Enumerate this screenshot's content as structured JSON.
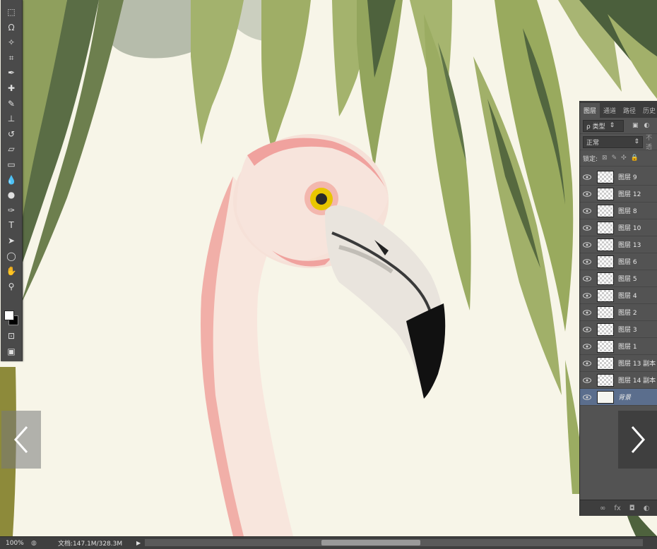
{
  "toolbar": {
    "tools": [
      {
        "name": "marquee-tool-icon",
        "glyph": "⬚"
      },
      {
        "name": "lasso-tool-icon",
        "glyph": "ᘯ"
      },
      {
        "name": "magic-wand-tool-icon",
        "glyph": "✧"
      },
      {
        "name": "crop-tool-icon",
        "glyph": "⌗"
      },
      {
        "name": "eyedropper-tool-icon",
        "glyph": "✒"
      },
      {
        "name": "healing-brush-tool-icon",
        "glyph": "✚"
      },
      {
        "name": "brush-tool-icon",
        "glyph": "✎"
      },
      {
        "name": "clone-stamp-tool-icon",
        "glyph": "⊥"
      },
      {
        "name": "history-brush-tool-icon",
        "glyph": "↺"
      },
      {
        "name": "eraser-tool-icon",
        "glyph": "▱"
      },
      {
        "name": "gradient-tool-icon",
        "glyph": "▭"
      },
      {
        "name": "blur-tool-icon",
        "glyph": "💧"
      },
      {
        "name": "dodge-tool-icon",
        "glyph": "●"
      },
      {
        "name": "pen-tool-icon",
        "glyph": "✑"
      },
      {
        "name": "type-tool-icon",
        "glyph": "T"
      },
      {
        "name": "path-selection-tool-icon",
        "glyph": "➤"
      },
      {
        "name": "ellipse-tool-icon",
        "glyph": "◯"
      },
      {
        "name": "hand-tool-icon",
        "glyph": "✋"
      },
      {
        "name": "zoom-tool-icon",
        "glyph": "⚲"
      }
    ],
    "swatch_colors": {
      "foreground": "#ffffff",
      "background": "#000000"
    },
    "quick_mask_glyph": "⊡",
    "screen_mode_glyph": "▣"
  },
  "layers_panel": {
    "tabs": [
      "图层",
      "通道",
      "路径",
      "历史"
    ],
    "filter_label": "ρ 类型",
    "blend_mode": "正常",
    "opacity_label": "不透",
    "lock_label": "锁定:",
    "layers": [
      {
        "name": "图层 9",
        "selected": false
      },
      {
        "name": "图层 12",
        "selected": false
      },
      {
        "name": "图层 8",
        "selected": false
      },
      {
        "name": "图层 10",
        "selected": false
      },
      {
        "name": "图层 13",
        "selected": false
      },
      {
        "name": "图层 6",
        "selected": false
      },
      {
        "name": "图层 5",
        "selected": false
      },
      {
        "name": "图层 4",
        "selected": false
      },
      {
        "name": "图层 2",
        "selected": false
      },
      {
        "name": "图层 3",
        "selected": false
      },
      {
        "name": "图层 1",
        "selected": false
      },
      {
        "name": "图层 13 副本",
        "selected": false
      },
      {
        "name": "图层 14 副本",
        "selected": false
      },
      {
        "name": "背景",
        "selected": true
      }
    ],
    "footer_icons": [
      "∞",
      "fx",
      "◘",
      "◐"
    ]
  },
  "nav": {
    "prev_glyph": "‹",
    "next_glyph": "›"
  },
  "statusbar": {
    "zoom": "100%",
    "doc_info": "文档:147.1M/328.3M",
    "arrow": "▶"
  },
  "colors": {
    "canvas_bg": "#f7f5e8",
    "leaf_light": "#9fae6a",
    "leaf_dark": "#4f6340",
    "flamingo_pink": "#f0a9a4",
    "eye_yellow": "#e8c600"
  }
}
